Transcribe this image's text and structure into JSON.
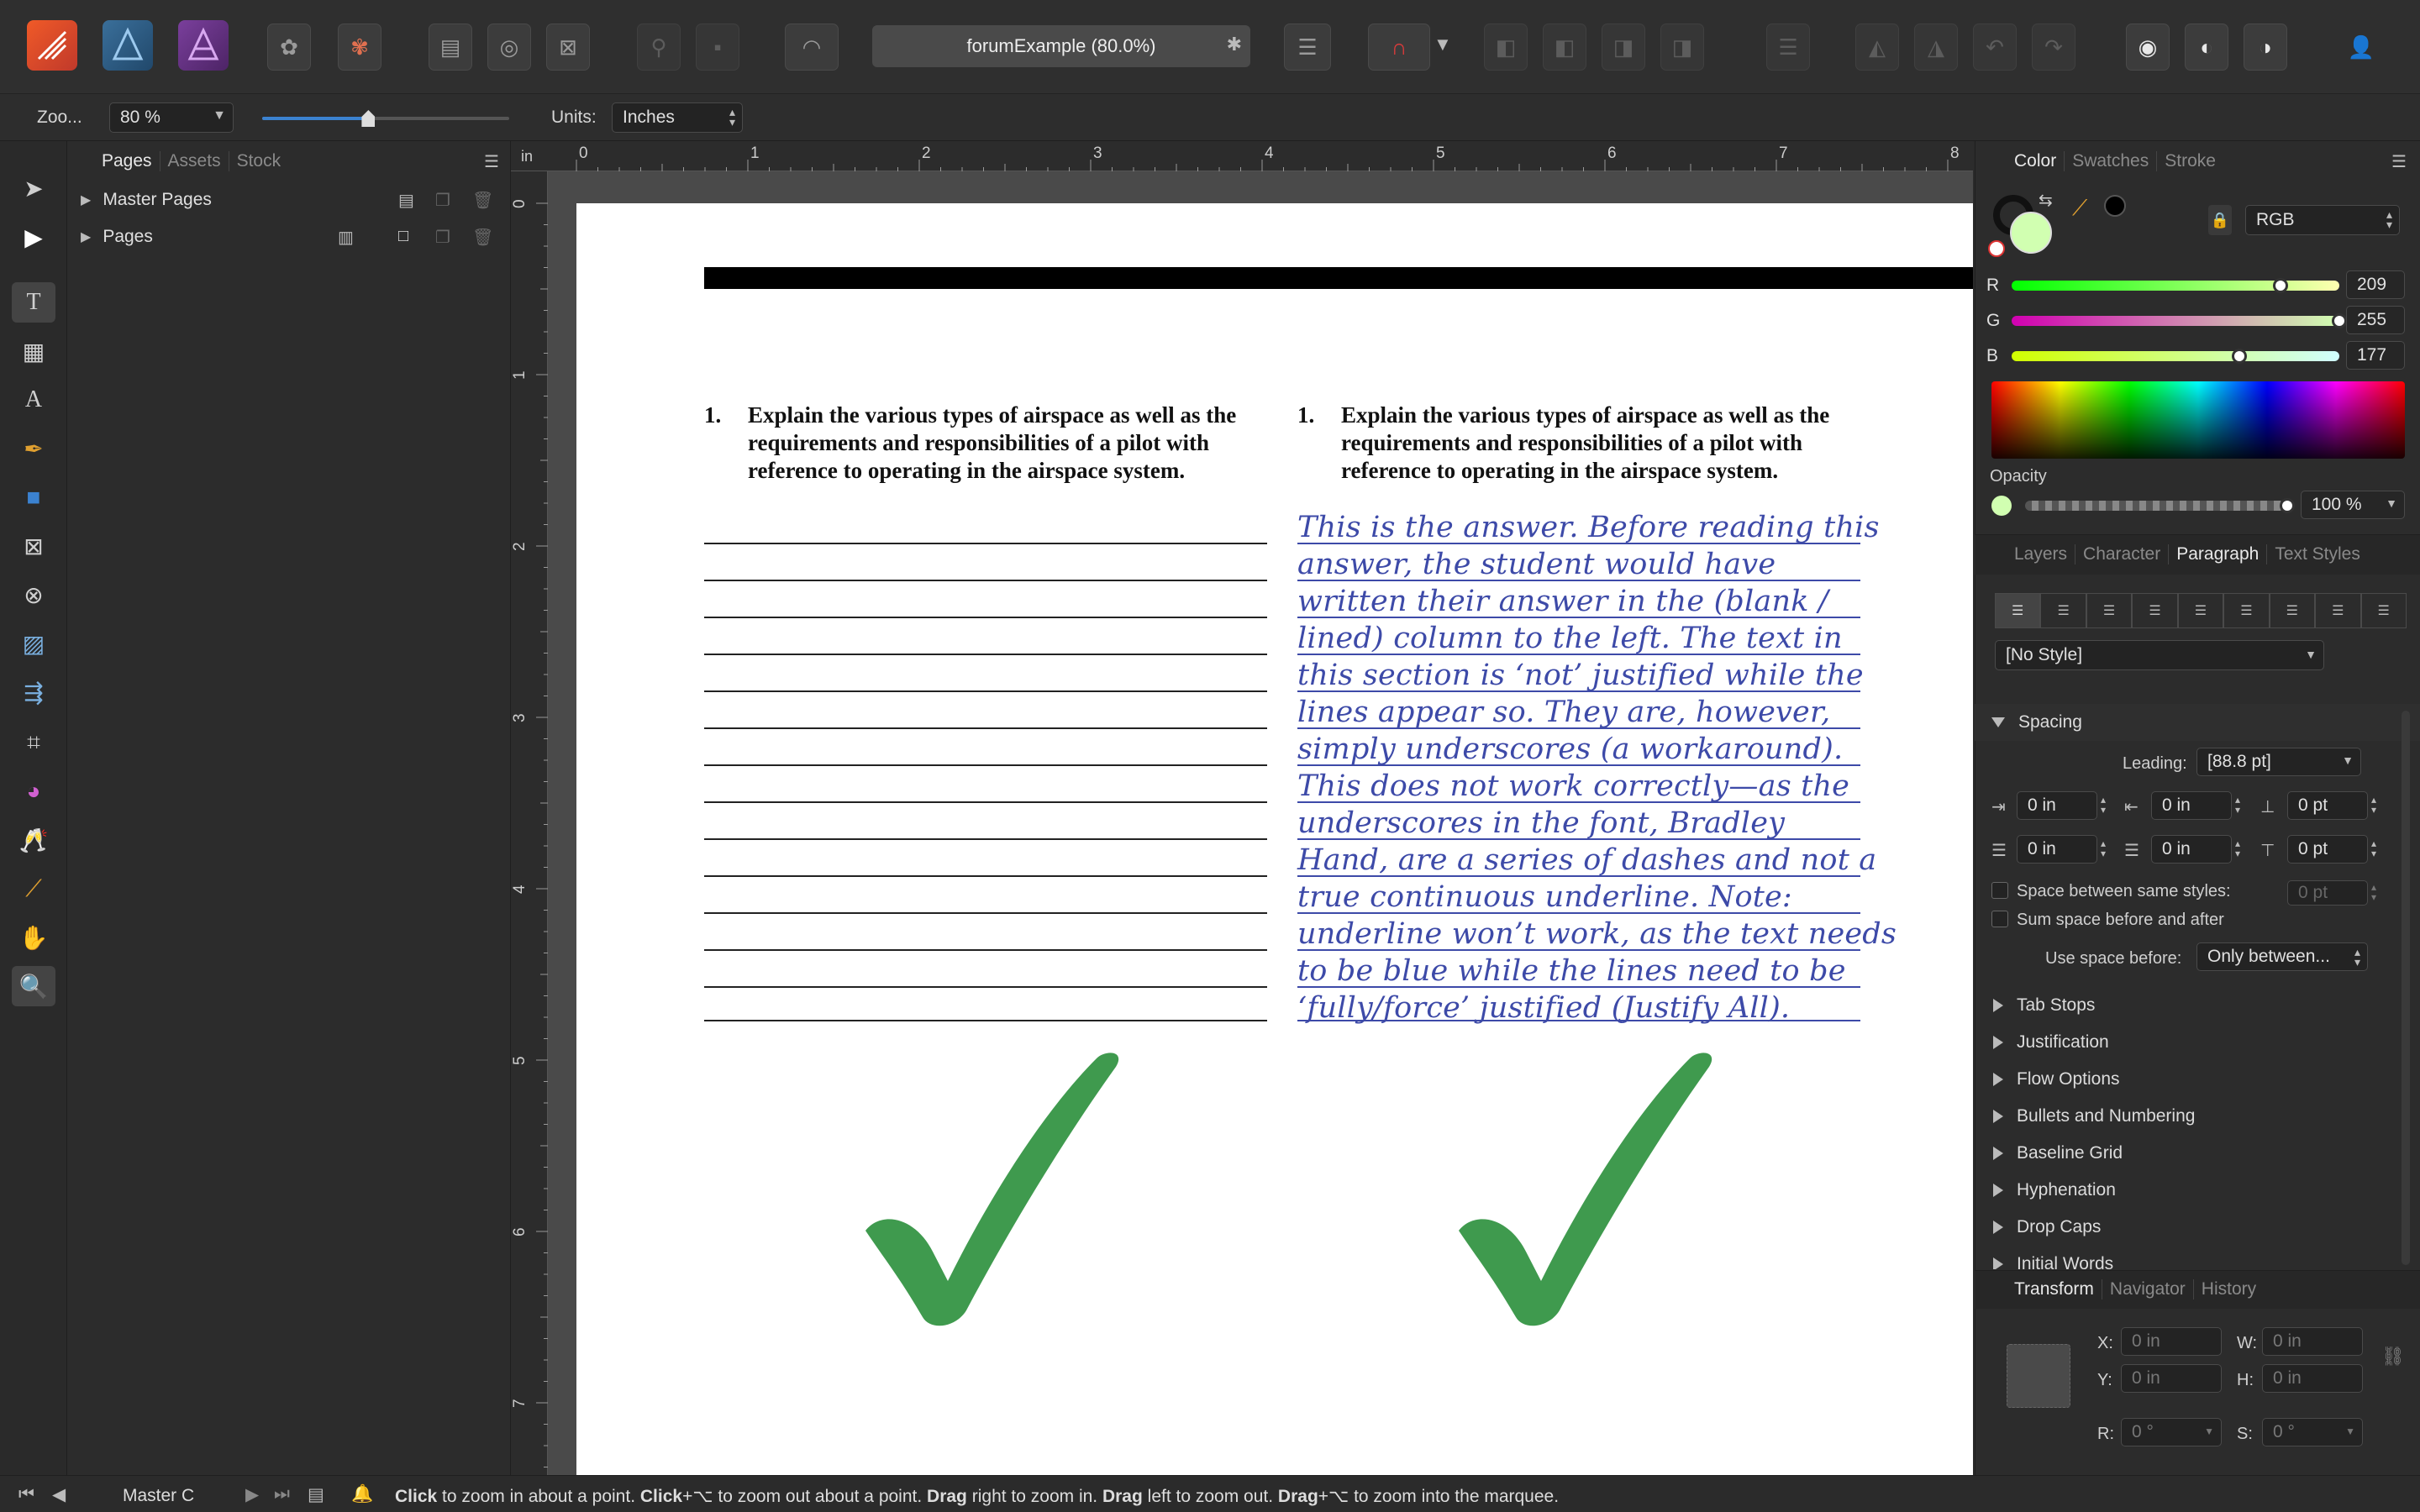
{
  "toolbar": {
    "document_title": "forumExample (80.0%)"
  },
  "context": {
    "zoom_label": "Zoo...",
    "zoom_value": "80 %",
    "zoom_slider_level": 0.43,
    "units_label": "Units:",
    "units_value": "Inches"
  },
  "pages_panel": {
    "tabs": [
      "Pages",
      "Assets",
      "Stock"
    ],
    "items": [
      "Master Pages",
      "Pages"
    ]
  },
  "ruler": {
    "unit": "in",
    "h_ticks": [
      "0",
      "1",
      "2",
      "3",
      "4",
      "5",
      "6",
      "7",
      "8"
    ],
    "v_ticks": [
      "0",
      "1",
      "2",
      "3",
      "4",
      "5",
      "6",
      "7"
    ]
  },
  "document": {
    "left_number": "1.",
    "left_question": "Explain the various types of airspace as well as the requirements and responsibilities of a pilot with reference to operating in the airspace system.",
    "right_number": "1.",
    "right_question": "Explain the various types of airspace as well as the requirements and responsibilities of a pilot with reference to operating in the airspace system.",
    "answer_lines": [
      "This is the answer. Before reading this",
      "answer, the student would have",
      "written their answer in the (blank /",
      "lined) column to the left. The text in",
      "this section is ‘not’ justified while the",
      "lines appear so. They are, however,",
      "simply underscores (a workaround).",
      "This does not work correctly—as the",
      "underscores in the font, Bradley",
      "Hand, are a series of dashes and not a",
      "true continuous underline. Note:",
      "underline won’t work, as the text needs",
      "to be blue while the lines need to be",
      "‘fully/force’ justified (Justify All)."
    ],
    "checkmark_color": "#3f9a4e",
    "answer_color": "#3d4aa8"
  },
  "color_panel": {
    "tabs": [
      "Color",
      "Swatches",
      "Stroke"
    ],
    "mode": "RGB",
    "r_label": "R",
    "r_value": "209",
    "g_label": "G",
    "g_value": "255",
    "b_label": "B",
    "b_value": "177",
    "fill_color": "#d1ffb1",
    "opacity_label": "Opacity",
    "opacity_value": "100 %"
  },
  "paragraph_panel": {
    "tabs": [
      "Layers",
      "Character",
      "Paragraph",
      "Text Styles"
    ],
    "style": "[No Style]",
    "spacing_label": "Spacing",
    "leading_label": "Leading:",
    "leading_value": "[88.8 pt]",
    "indent_left": "0 in",
    "indent_right": "0 in",
    "space_before": "0 pt",
    "first_line": "0 in",
    "last_line": "0 in",
    "space_after": "0 pt",
    "same_styles_label": "Space between same styles:",
    "same_styles_value": "0 pt",
    "sum_space_label": "Sum space before and after",
    "use_space_label": "Use space before:",
    "use_space_value": "Only between...",
    "sections": [
      "Tab Stops",
      "Justification",
      "Flow Options",
      "Bullets and Numbering",
      "Baseline Grid",
      "Hyphenation",
      "Drop Caps",
      "Initial Words"
    ]
  },
  "transform_panel": {
    "tabs": [
      "Transform",
      "Navigator",
      "History"
    ],
    "x_label": "X:",
    "x_value": "0 in",
    "y_label": "Y:",
    "y_value": "0 in",
    "w_label": "W:",
    "w_value": "0 in",
    "h_label": "H:",
    "h_value": "0 in",
    "r_label": "R:",
    "r_value": "0 °",
    "s_label": "S:",
    "s_value": "0 °"
  },
  "status": {
    "master": "Master C",
    "hint_1": "Click",
    "hint_2": " to zoom in about a point. ",
    "hint_3": "Click",
    "hint_4": "+⌥ to zoom out about a point. ",
    "hint_5": "Drag",
    "hint_6": " right to zoom in. ",
    "hint_7": "Drag",
    "hint_8": " left to zoom out. ",
    "hint_9": "Drag",
    "hint_10": "+⌥ to zoom into the marquee."
  }
}
